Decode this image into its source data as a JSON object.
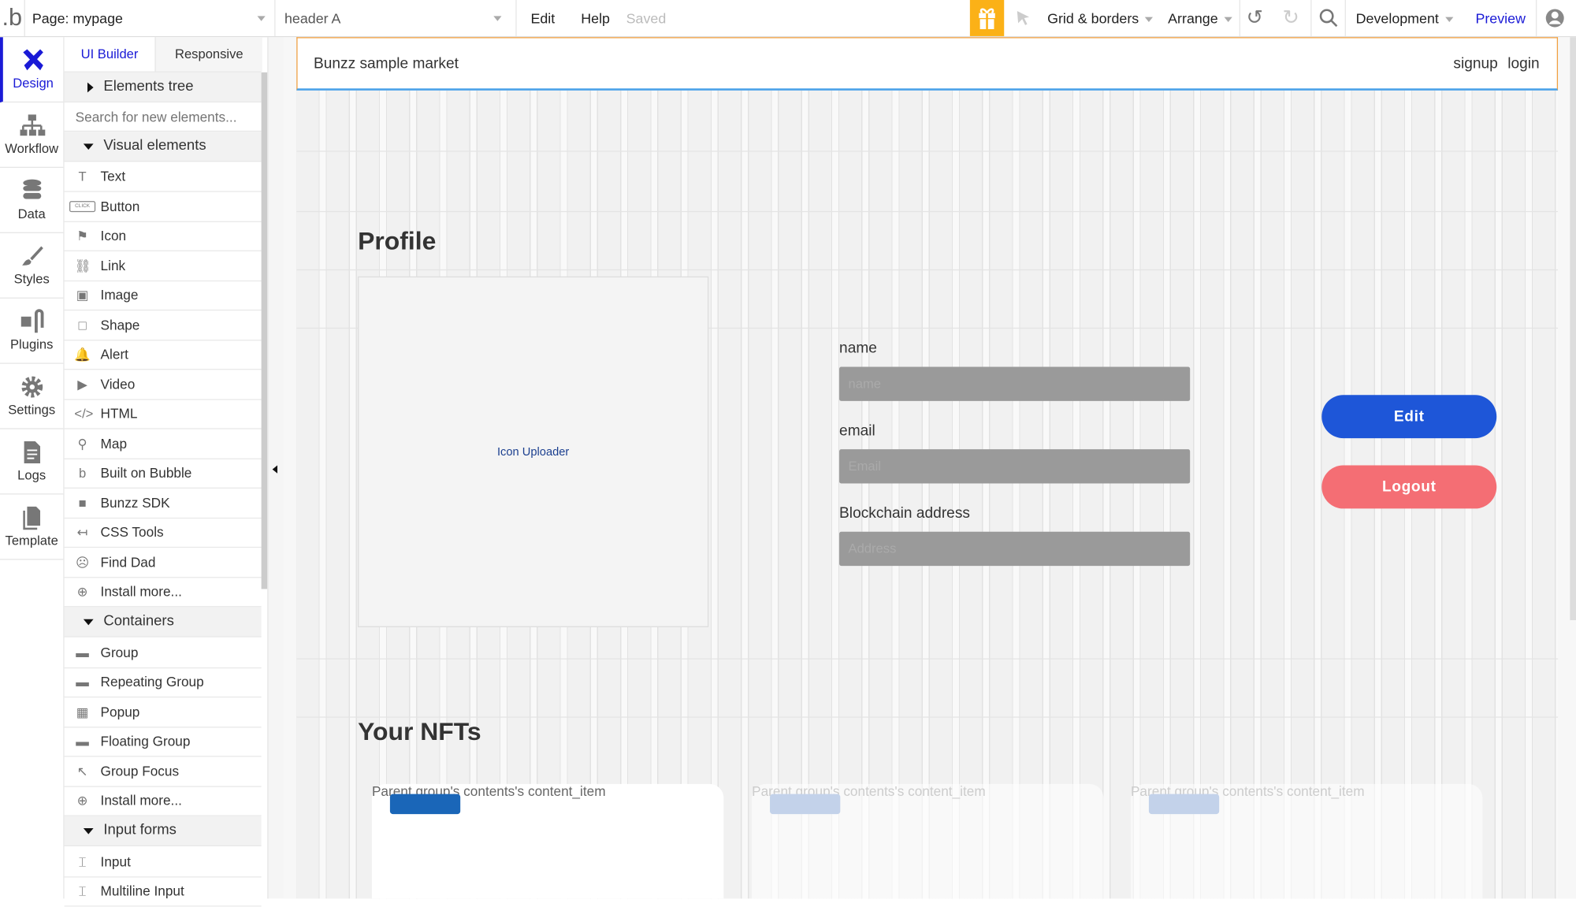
{
  "topbar": {
    "page_select": "Page: mypage",
    "element_select": "header A",
    "edit": "Edit",
    "help": "Help",
    "status": "Saved",
    "grid_borders": "Grid & borders",
    "arrange": "Arrange",
    "environment": "Development",
    "preview": "Preview"
  },
  "leftnav": {
    "items": [
      {
        "label": "Design",
        "icon": "design-icon",
        "active": true
      },
      {
        "label": "Workflow",
        "icon": "workflow-icon"
      },
      {
        "label": "Data",
        "icon": "database-icon"
      },
      {
        "label": "Styles",
        "icon": "brush-icon"
      },
      {
        "label": "Plugins",
        "icon": "plug-icon"
      },
      {
        "label": "Settings",
        "icon": "gear-icon"
      },
      {
        "label": "Logs",
        "icon": "document-icon"
      },
      {
        "label": "Template",
        "icon": "template-icon"
      }
    ]
  },
  "panel": {
    "tabs": [
      "UI Builder",
      "Responsive"
    ],
    "elements_tree": "Elements tree",
    "search_placeholder": "Search for new elements...",
    "sections": [
      {
        "title": "Visual elements",
        "items": [
          "Text",
          "Button",
          "Icon",
          "Link",
          "Image",
          "Shape",
          "Alert",
          "Video",
          "HTML",
          "Map",
          "Built on Bubble",
          "Bunzz SDK",
          "CSS Tools",
          "Find Dad",
          "Install more..."
        ]
      },
      {
        "title": "Containers",
        "items": [
          "Group",
          "Repeating Group",
          "Popup",
          "Floating Group",
          "Group Focus",
          "Install more..."
        ]
      },
      {
        "title": "Input forms",
        "items": [
          "Input",
          "Multiline Input"
        ]
      }
    ],
    "button_icon_text": "CLICK"
  },
  "page": {
    "header": {
      "brand": "Bunzz sample market",
      "signup": "signup",
      "login": "login"
    },
    "profile_title": "Profile",
    "icon_uploader": "Icon Uploader",
    "fields": [
      {
        "label": "name",
        "placeholder": "name"
      },
      {
        "label": "email",
        "placeholder": "Email"
      },
      {
        "label": "Blockchain address",
        "placeholder": "Address"
      }
    ],
    "edit_button": "Edit",
    "logout_button": "Logout",
    "nfts_title": "Your NFTs",
    "nft_cards": [
      "Parent group's contents's content_item",
      "Parent group's contents's content_item",
      "Parent group's contents's content_item"
    ]
  },
  "colors": {
    "accent": "#1a1ad6",
    "edit": "#1e56d8",
    "logout": "#f46e74",
    "gift": "#fbb117",
    "nft_block": "#1a66b8"
  }
}
